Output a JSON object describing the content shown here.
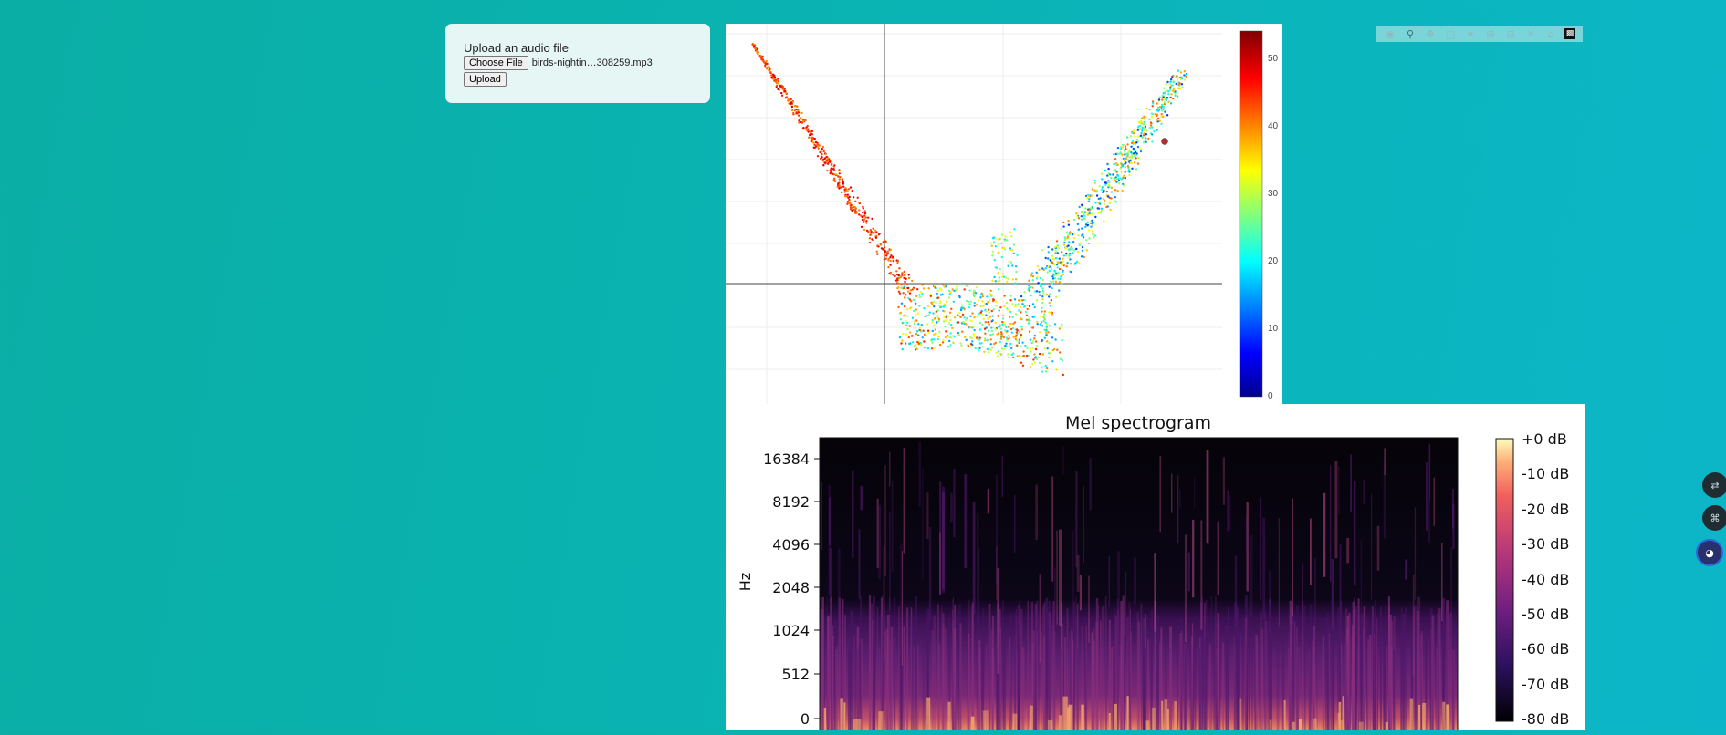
{
  "upload": {
    "title": "Upload an audio file",
    "choose_label": "Choose File",
    "file_name": "birds-nightin…308259.mp3",
    "upload_label": "Upload"
  },
  "toolbar": {
    "icons": [
      "camera-icon",
      "zoom-icon",
      "pan-icon",
      "box-select-icon",
      "lasso-icon",
      "zoom-in-icon",
      "zoom-out-icon",
      "autoscale-icon",
      "reset-axes-icon",
      "plotly-logo-icon"
    ]
  },
  "scatter": {
    "colorbar": {
      "ticks": [
        "50",
        "40",
        "30",
        "20",
        "10",
        "0"
      ],
      "min": 0,
      "max": 54
    },
    "colorscale": [
      "#00008f",
      "#0000ff",
      "#00ffff",
      "#ffff00",
      "#ff0000",
      "#800000"
    ]
  },
  "spectrogram": {
    "title": "Mel spectrogram",
    "ylabel": "Hz",
    "yticks": [
      "16384",
      "8192",
      "4096",
      "2048",
      "1024",
      "512",
      "0"
    ],
    "colorbar_ticks": [
      "+0 dB",
      "-10 dB",
      "-20 dB",
      "-30 dB",
      "-40 dB",
      "-50 dB",
      "-60 dB",
      "-70 dB",
      "-80 dB"
    ]
  },
  "side_buttons": [
    "translate-icon",
    "shortcut-icon",
    "assistant-icon"
  ]
}
